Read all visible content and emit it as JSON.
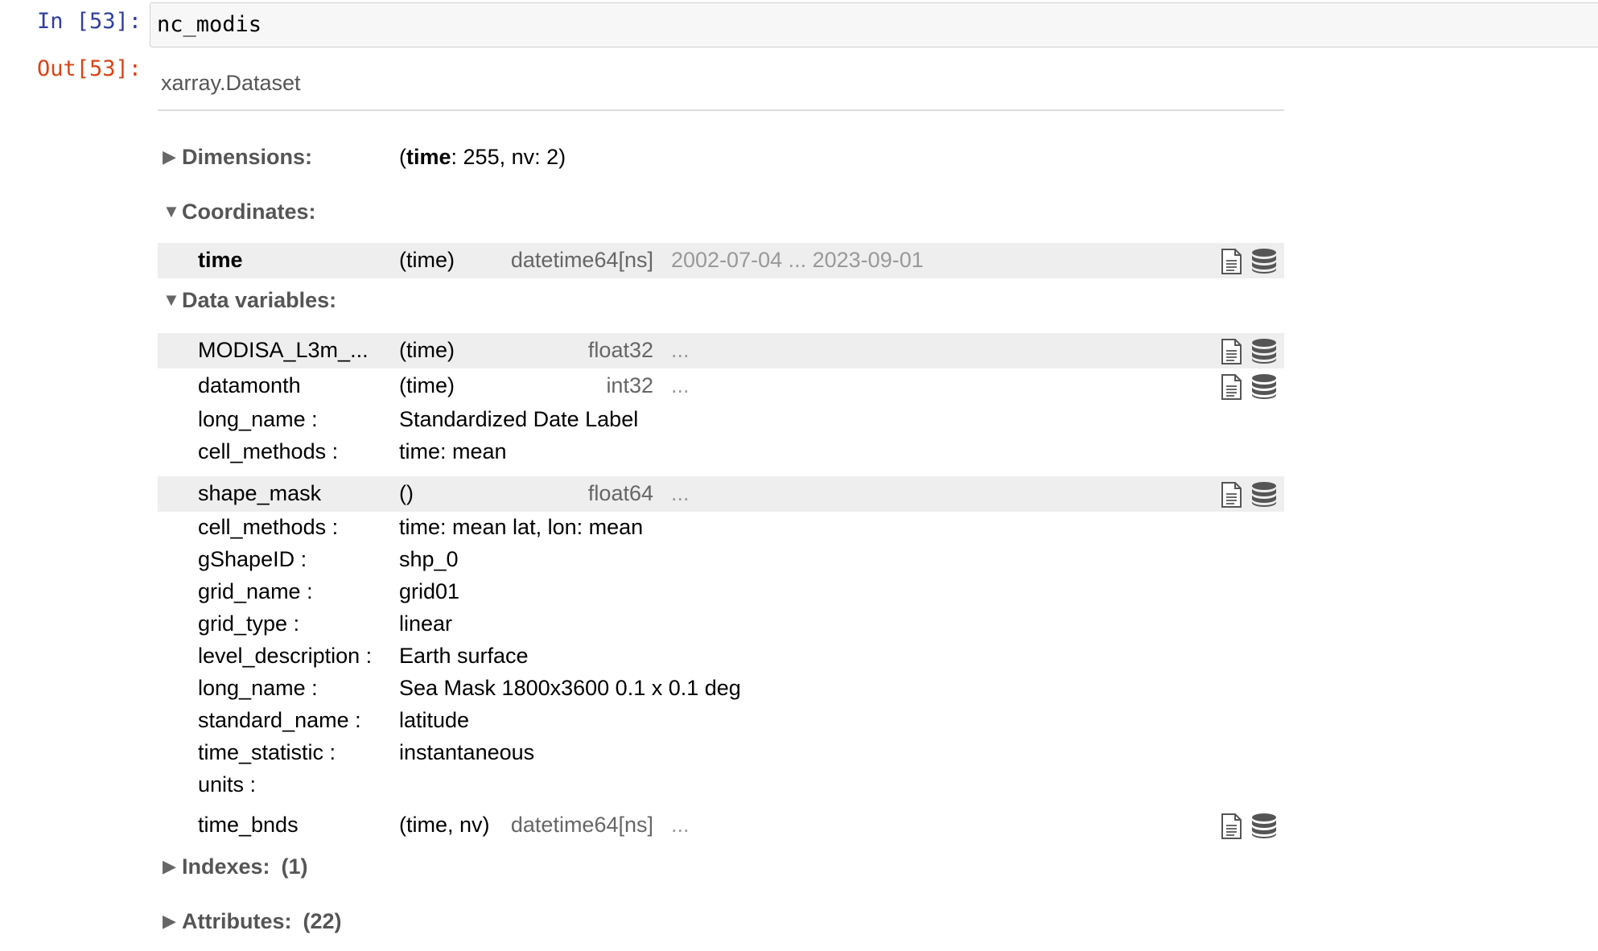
{
  "cell": {
    "in_prompt": "In [53]:",
    "out_prompt": "Out[53]:",
    "code": "nc_modis"
  },
  "dataset": {
    "type_label": "xarray.Dataset",
    "dimensions": {
      "label": "Dimensions:",
      "open": "▶",
      "value_time_name": "time",
      "value_time_rest": ": 255, nv: 2)",
      "value_prefix": "("
    },
    "coordinates": {
      "label": "Coordinates:",
      "open": "▼",
      "rows": [
        {
          "name": "time",
          "dims": "(time)",
          "dtype": "datetime64[ns]",
          "preview": "2002-07-04 ... 2023-09-01"
        }
      ]
    },
    "data_variables": {
      "label": "Data variables:",
      "open": "▼",
      "rows": [
        {
          "name": "MODISA_L3m_...",
          "dims": "(time)",
          "dtype": "float32",
          "preview": "..."
        },
        {
          "name": "datamonth",
          "dims": "(time)",
          "dtype": "int32",
          "preview": "...",
          "attrs": [
            {
              "k": "long_name :",
              "v": "Standardized Date Label"
            },
            {
              "k": "cell_methods :",
              "v": "time: mean"
            }
          ]
        },
        {
          "name": "shape_mask",
          "dims": "()",
          "dtype": "float64",
          "preview": "...",
          "attrs": [
            {
              "k": "cell_methods :",
              "v": "time: mean lat, lon: mean"
            },
            {
              "k": "gShapeID :",
              "v": "shp_0"
            },
            {
              "k": "grid_name :",
              "v": "grid01"
            },
            {
              "k": "grid_type :",
              "v": "linear"
            },
            {
              "k": "level_description :",
              "v": "Earth surface"
            },
            {
              "k": "long_name :",
              "v": "Sea Mask 1800x3600 0.1 x 0.1 deg"
            },
            {
              "k": "standard_name :",
              "v": "latitude"
            },
            {
              "k": "time_statistic :",
              "v": "instantaneous"
            },
            {
              "k": "units :",
              "v": ""
            }
          ]
        },
        {
          "name": "time_bnds",
          "dims": "(time, nv)",
          "dtype": "datetime64[ns]",
          "preview": "..."
        }
      ]
    },
    "indexes": {
      "label": "Indexes:",
      "open": "▶",
      "count": "(1)"
    },
    "attributes": {
      "label": "Attributes:",
      "open": "▶",
      "count": "(22)"
    }
  },
  "colors": {
    "in_prompt": "#303f9f",
    "out_prompt": "#d84315",
    "row_shade": "#eeeeee",
    "icon": "#555555"
  },
  "icons": {
    "doc": "file-text-icon",
    "db": "database-icon"
  }
}
